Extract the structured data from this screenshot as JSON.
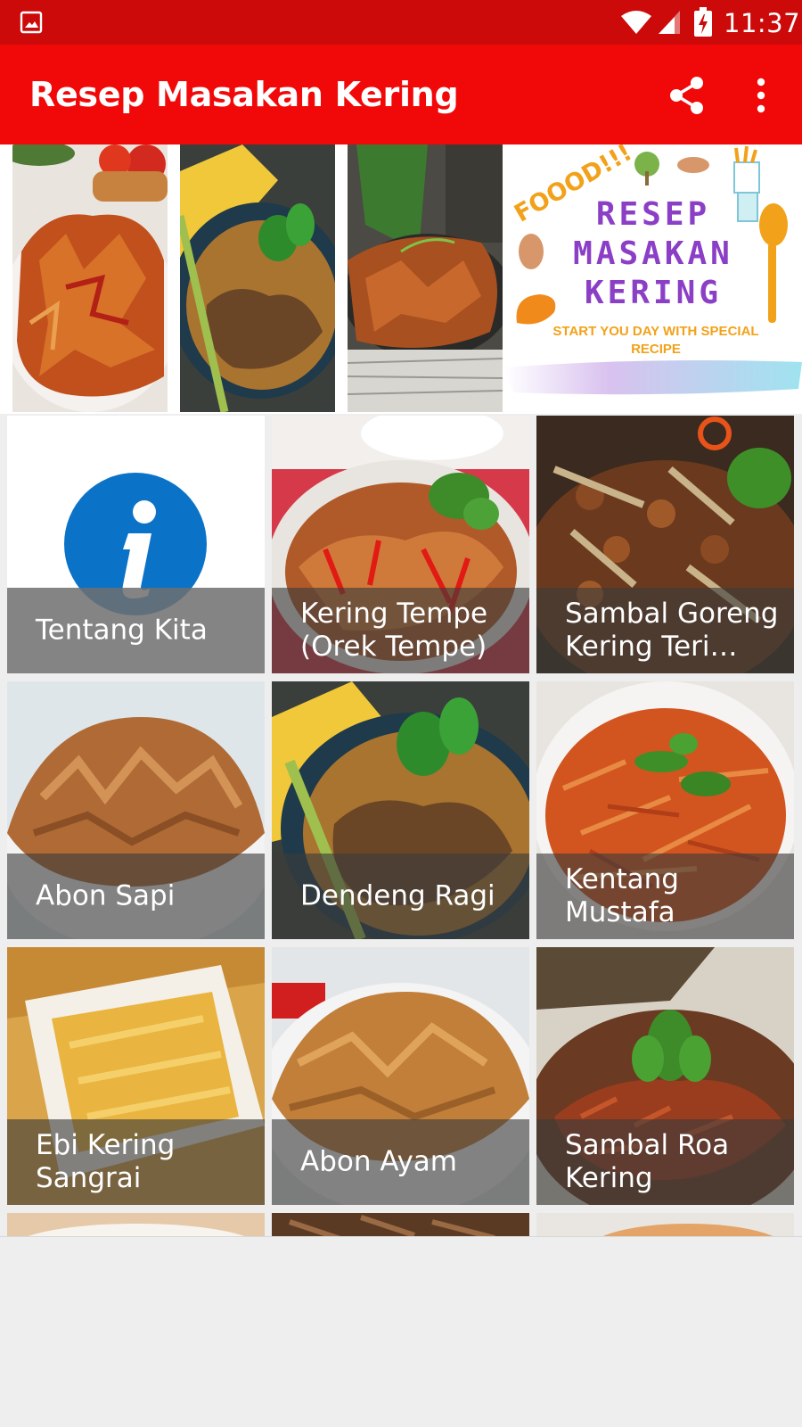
{
  "status_bar": {
    "time": "11:37",
    "icons": [
      "gallery-icon",
      "wifi-icon",
      "cell-signal-icon",
      "battery-charging-icon"
    ]
  },
  "app_bar": {
    "title": "Resep Masakan Kering",
    "actions": [
      "share-icon",
      "more-vert-icon"
    ]
  },
  "banner": {
    "promo_exclaim": "FOOOD!!!",
    "promo_line1": "RESEP",
    "promo_line2": "MASAKAN",
    "promo_line3": "KERING",
    "promo_tagline": "START YOU DAY WITH SPECIAL RECIPE"
  },
  "grid": {
    "items": [
      {
        "label": "Tentang Kita",
        "icon": "info-icon"
      },
      {
        "label": "Kering Tempe (Orek Tempe)"
      },
      {
        "label": "Sambal Goreng Kering Teri…"
      },
      {
        "label": "Abon Sapi"
      },
      {
        "label": "Dendeng Ragi"
      },
      {
        "label": "Kentang Mustafa"
      },
      {
        "label": "Ebi Kering Sangrai"
      },
      {
        "label": "Abon Ayam"
      },
      {
        "label": "Sambal Roa Kering"
      }
    ]
  },
  "colors": {
    "status_bar": "#cc0a0a",
    "app_bar": "#f10808",
    "info_blue": "#0a73c8",
    "promo_purple": "#8b3fc6",
    "promo_orange": "#f2a21a"
  }
}
